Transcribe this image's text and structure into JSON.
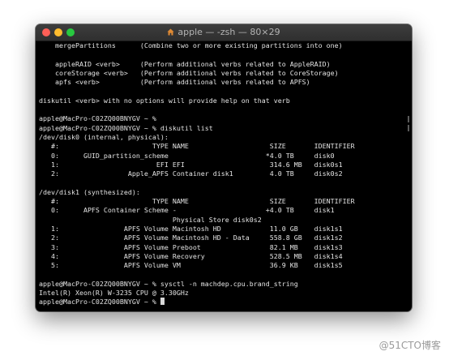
{
  "window": {
    "title": "apple — -zsh — 80×29",
    "title_icon": "house-icon",
    "controls": [
      "close",
      "minimize",
      "zoom"
    ]
  },
  "terminal": {
    "lines": [
      "    mergePartitions      (Combine two or more existing partitions into one)",
      "",
      "    appleRAID <verb>     (Perform additional verbs related to AppleRAID)",
      "    coreStorage <verb>   (Perform additional verbs related to CoreStorage)",
      "    apfs <verb>          (Perform additional verbs related to APFS)",
      "",
      "diskutil <verb> with no options will provide help on that verb",
      "",
      "apple@MacPro-C02ZQ00BNYGV ~ %",
      "apple@MacPro-C02ZQ00BNYGV ~ % diskutil list",
      "/dev/disk0 (internal, physical):",
      "   #:                       TYPE NAME                    SIZE       IDENTIFIER",
      "   0:      GUID_partition_scheme                        *4.0 TB     disk0",
      "   1:                        EFI EFI                     314.6 MB   disk0s1",
      "   2:                 Apple_APFS Container disk1         4.0 TB     disk0s2",
      "",
      "/dev/disk1 (synthesized):",
      "   #:                       TYPE NAME                    SIZE       IDENTIFIER",
      "   0:      APFS Container Scheme -                      +4.0 TB     disk1",
      "                                 Physical Store disk0s2",
      "   1:                APFS Volume Macintosh HD            11.0 GB    disk1s1",
      "   2:                APFS Volume Macintosh HD - Data     558.8 GB   disk1s2",
      "   3:                APFS Volume Preboot                 82.1 MB    disk1s3",
      "   4:                APFS Volume Recovery                528.5 MB   disk1s4",
      "   5:                APFS Volume VM                      36.9 KB    disk1s5",
      "",
      "apple@MacPro-C02ZQ00BNYGV ~ % sysctl -n machdep.cpu.brand_string",
      "Intel(R) Xeon(R) W-3235 CPU @ 3.30GHz",
      "apple@MacPro-C02ZQ00BNYGV ~ % "
    ]
  },
  "watermark": "@51CTO博客",
  "colors": {
    "terminal_bg": "#000000",
    "terminal_text": "#e4e4e4",
    "titlebar": "#353535",
    "close": "#fe5f57",
    "minimize": "#febc2e",
    "zoom": "#28c840"
  }
}
